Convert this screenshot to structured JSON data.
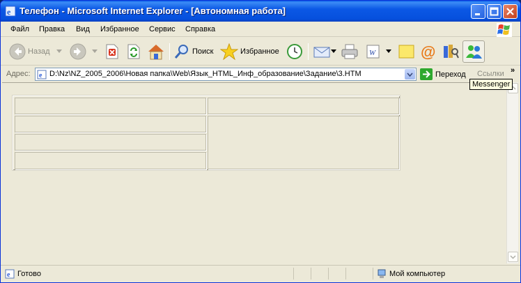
{
  "window": {
    "title": "Телефон - Microsoft Internet Explorer - [Автономная работа]"
  },
  "menu": {
    "items": [
      "Файл",
      "Правка",
      "Вид",
      "Избранное",
      "Сервис",
      "Справка"
    ]
  },
  "toolbar": {
    "back_label": "Назад",
    "search_label": "Поиск",
    "favorites_label": "Избранное"
  },
  "address": {
    "label": "Адрес:",
    "value": "D:\\Nz\\NZ_2005_2006\\Новая папка\\Web\\Язык_HTML_Инф_образование\\Задание\\3.HTM",
    "go_label": "Переход",
    "links_label": "Ссылки"
  },
  "tooltip": {
    "text": "Messenger"
  },
  "status": {
    "left": "Готово",
    "zone": "Мой компьютер"
  }
}
